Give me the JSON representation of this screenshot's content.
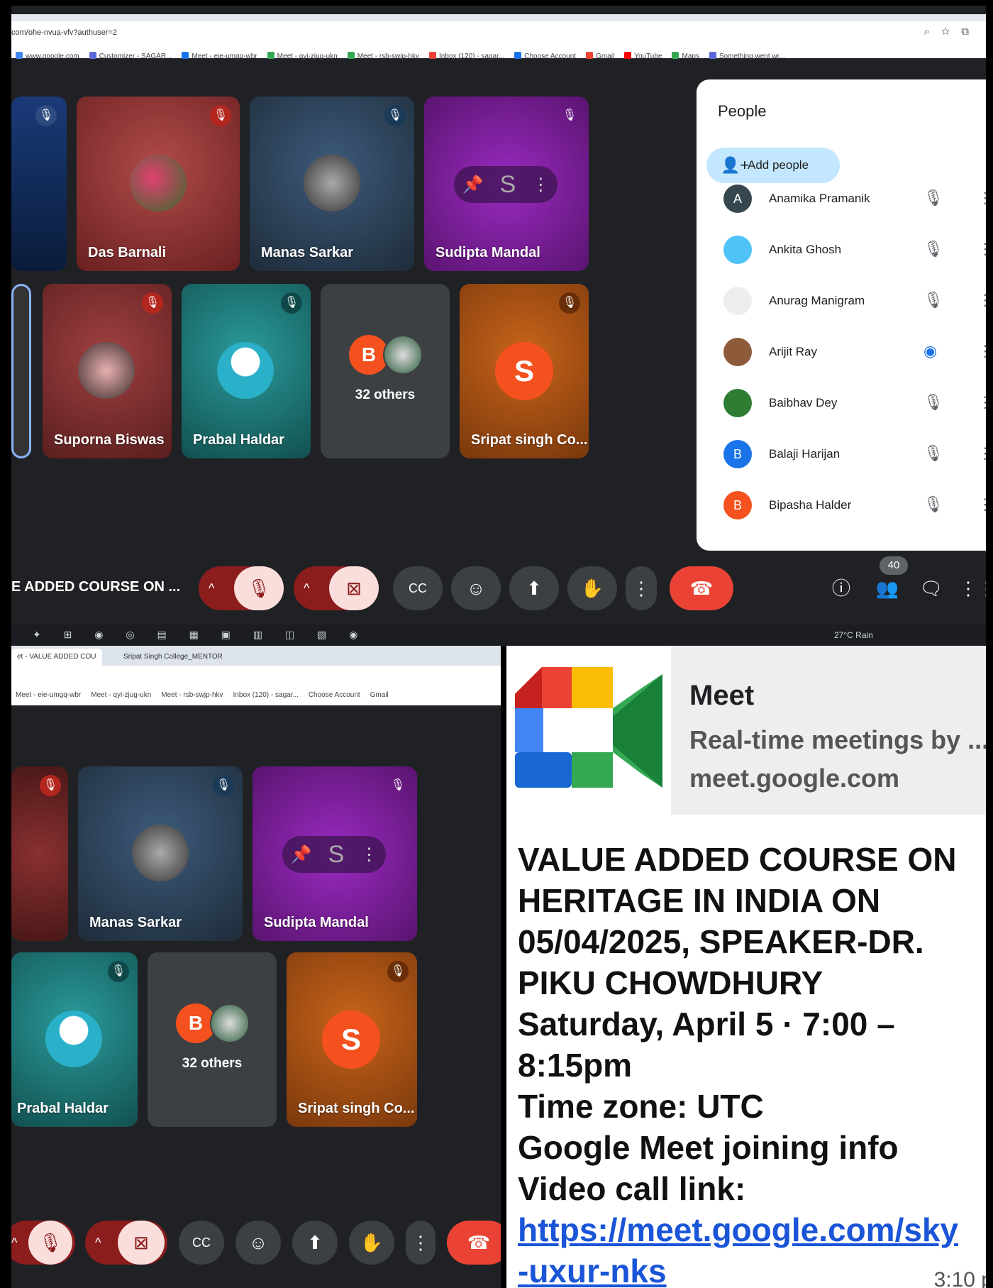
{
  "top": {
    "url": "com/ohe-nvua-vfv?authuser=2",
    "bookmarks": [
      {
        "label": "www.google.com",
        "color": "#4285f4"
      },
      {
        "label": "Customizer - SAGAR...",
        "color": "#5b6ad6"
      },
      {
        "label": "Meet - eie-umgq-wbr",
        "color": "#1a73e8"
      },
      {
        "label": "Meet - qyi-zjug-ukn",
        "color": "#34a853"
      },
      {
        "label": "Meet - rsb-swjp-hkv",
        "color": "#34a853"
      },
      {
        "label": "Inbox (120) - sagar...",
        "color": "#ea4335"
      },
      {
        "label": "Choose Account",
        "color": "#1a73e8"
      },
      {
        "label": "Gmail",
        "color": "#ea4335"
      },
      {
        "label": "YouTube",
        "color": "#ff0000"
      },
      {
        "label": "Maps",
        "color": "#34a853"
      },
      {
        "label": "Something went wr...",
        "color": "#5b6ad6"
      }
    ],
    "tiles": {
      "das": "Das Barnali",
      "manas": "Manas Sarkar",
      "sudipta": "Sudipta Mandal",
      "suporna": "Suporna Biswas",
      "prabal": "Prabal Haldar",
      "others_letter": "B",
      "others": "32 others",
      "sripat": "Sripat singh Co...",
      "sripat_letter": "S"
    },
    "people_panel": {
      "title": "People",
      "add_label": "Add people",
      "people": [
        {
          "name": "Anamika Pramanik",
          "initial": "A",
          "color": "#37474f"
        },
        {
          "name": "Ankita Ghosh",
          "initial": "",
          "color": "#4fc3f7"
        },
        {
          "name": "Anurag Manigram",
          "initial": "",
          "color": "#eeeeee"
        },
        {
          "name": "Arijit Ray",
          "initial": "",
          "color": "#8d5a3a"
        },
        {
          "name": "Baibhav Dey",
          "initial": "",
          "color": "#2e7d32"
        },
        {
          "name": "Balaji Harijan",
          "initial": "B",
          "color": "#1a73e8"
        },
        {
          "name": "Bipasha Halder",
          "initial": "B",
          "color": "#f4511e"
        }
      ]
    },
    "meeting_title": "E ADDED COURSE ON ...",
    "participant_count": "40",
    "taskbar_weather": "27°C Rain"
  },
  "bottom_left": {
    "tab1": "et - VALUE ADDED COU",
    "tab2": "Sripat Singh College_MENTOR",
    "bookmarks": [
      "Meet - eie-umgq-wbr",
      "Meet - qyi-zjug-ukn",
      "Meet - rsb-swjp-hkv",
      "Inbox (120) - sagar...",
      "Choose Account",
      "Gmail"
    ],
    "tiles": {
      "manas": "Manas Sarkar",
      "sudipta": "Sudipta Mandal",
      "prabal": "Prabal Haldar",
      "others_letter": "B",
      "others": "32 others",
      "sripat": "Sripat singh Co...",
      "sripat_letter": "S"
    }
  },
  "message": {
    "card_title": "Meet",
    "card_desc": "Real-time meetings by ...",
    "card_domain": "meet.google.com",
    "lines": [
      "VALUE ADDED COURSE ON",
      "HERITAGE IN INDIA ON",
      "05/04/2025, SPEAKER-DR.",
      "PIKU CHOWDHURY",
      "Saturday, April 5 · 7:00 –",
      "8:15pm",
      "Time zone: UTC",
      "Google Meet joining info",
      "Video call link:"
    ],
    "link_line1": "https://meet.google.com/sky",
    "link_line2": "-uxur-nks",
    "time": "3:10 p"
  }
}
